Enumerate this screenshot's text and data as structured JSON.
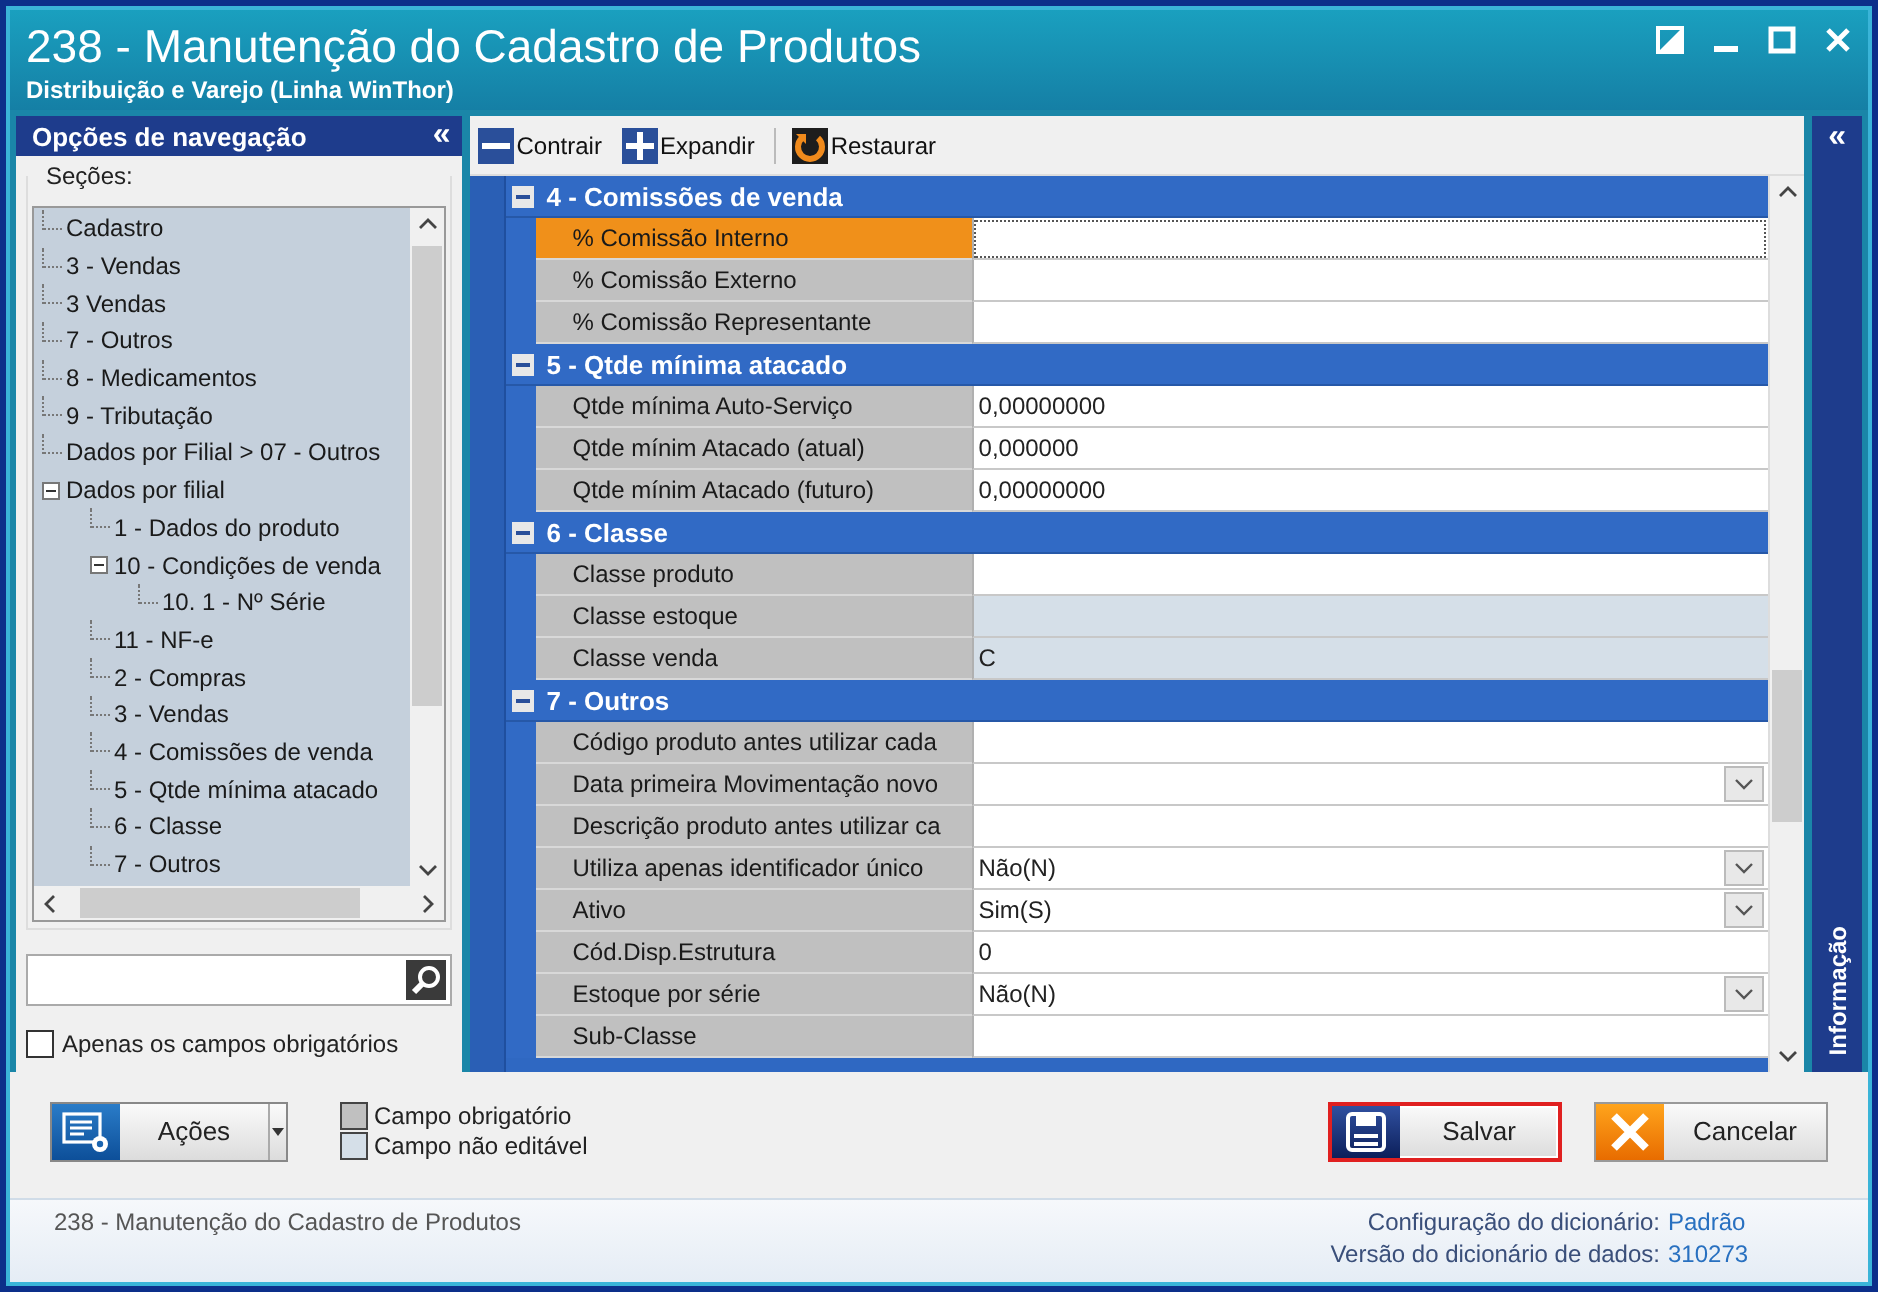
{
  "window": {
    "title": "238 - Manutenção do Cadastro de Produtos",
    "subtitle": "Distribuição e Varejo (Linha WinThor)"
  },
  "nav": {
    "title": "Opções de navegação",
    "collapse": "«",
    "sections_label": "Seções:",
    "tree": [
      {
        "label": "Cadastro"
      },
      {
        "label": "3 - Vendas"
      },
      {
        "label": "3 Vendas"
      },
      {
        "label": "7 - Outros"
      },
      {
        "label": "8 - Medicamentos"
      },
      {
        "label": "9 - Tributação"
      },
      {
        "label": "Dados por Filial > 07 - Outros"
      },
      {
        "label": "Dados por filial",
        "expanded": true,
        "children": [
          {
            "label": "1 - Dados do produto"
          },
          {
            "label": "10 - Condições de venda",
            "expanded": true,
            "children": [
              {
                "label": "10. 1 - Nº Série"
              }
            ]
          },
          {
            "label": "11 - NF-e"
          },
          {
            "label": "2 - Compras"
          },
          {
            "label": "3 - Vendas"
          },
          {
            "label": "4 - Comissões de venda"
          },
          {
            "label": "5 - Qtde mínima atacado"
          },
          {
            "label": "6 - Classe"
          },
          {
            "label": "7 - Outros"
          }
        ]
      }
    ],
    "only_required": {
      "label": "Apenas os campos obrigatórios",
      "checked": false
    }
  },
  "toolbar": [
    {
      "label": "Contrair",
      "kind": "collapse"
    },
    {
      "label": "Expandir",
      "kind": "expand"
    },
    {
      "label": "Restaurar",
      "kind": "restore"
    }
  ],
  "groups": [
    {
      "title": "4 - Comissões de venda",
      "expanded": true,
      "rows": [
        {
          "label": "% Comissão Interno",
          "kind": "text",
          "selected": true,
          "editable": true
        },
        {
          "label": "% Comissão Externo",
          "kind": "text",
          "selected": false,
          "editable": true
        },
        {
          "label": "% Comissão Representante",
          "kind": "text",
          "selected": false,
          "editable": true
        }
      ]
    },
    {
      "title": "5 - Qtde mínima atacado",
      "expanded": true,
      "rows": [
        {
          "label": "Qtde mínima Auto-Serviço",
          "value": "0,00000000",
          "kind": "text",
          "selected": false,
          "editable": true
        },
        {
          "label": "Qtde mínim Atacado (atual)",
          "value": "0,000000",
          "kind": "text",
          "selected": false,
          "editable": true
        },
        {
          "label": "Qtde mínim Atacado (futuro)",
          "value": "0,00000000",
          "kind": "text",
          "selected": false,
          "editable": true
        }
      ]
    },
    {
      "title": "6 - Classe",
      "expanded": true,
      "rows": [
        {
          "label": "Classe produto",
          "kind": "text",
          "selected": false,
          "editable": true
        },
        {
          "label": "Classe estoque",
          "kind": "text",
          "selected": false,
          "editable": false
        },
        {
          "label": "Classe venda",
          "value": "C",
          "kind": "text",
          "selected": false,
          "editable": false
        }
      ]
    },
    {
      "title": "7 - Outros",
      "expanded": true,
      "rows": [
        {
          "label": "Código produto antes utilizar cada",
          "kind": "text",
          "selected": false,
          "editable": true
        },
        {
          "label": "Data primeira Movimentação novo",
          "kind": "dropdown",
          "selected": false,
          "editable": true
        },
        {
          "label": "Descrição produto antes utilizar ca",
          "kind": "text",
          "selected": false,
          "editable": true
        },
        {
          "label": "Utiliza apenas identificador único",
          "value": "Não(N)",
          "kind": "dropdown",
          "selected": false,
          "editable": true
        },
        {
          "label": "Ativo",
          "value": "Sim(S)",
          "kind": "dropdown",
          "selected": false,
          "editable": true
        },
        {
          "label": "Cód.Disp.Estrutura",
          "value": "0",
          "kind": "text",
          "selected": false,
          "editable": true
        },
        {
          "label": "Estoque por série",
          "value": "Não(N)",
          "kind": "dropdown",
          "selected": false,
          "editable": true
        },
        {
          "label": "Sub-Classe",
          "kind": "text",
          "selected": false,
          "editable": true
        }
      ]
    }
  ],
  "info_panel": {
    "collapse": "«",
    "label": "Informação"
  },
  "footer": {
    "actions": {
      "label": "Ações"
    },
    "legend": [
      {
        "label": "Campo obrigatório",
        "kind": "required"
      },
      {
        "label": "Campo não editável",
        "kind": "readonly"
      }
    ],
    "buttons": [
      {
        "label": "Salvar",
        "kind": "save",
        "highlighted": true
      },
      {
        "label": "Cancelar",
        "kind": "cancel",
        "highlighted": false
      }
    ]
  },
  "status_bar": {
    "text": "238 - Manutenção do Cadastro de Produtos",
    "info": [
      {
        "label": "Configuração do dicionário:",
        "value": "Padrão"
      },
      {
        "label": "Versão do dicionário de dados:",
        "value": "310273"
      }
    ]
  }
}
